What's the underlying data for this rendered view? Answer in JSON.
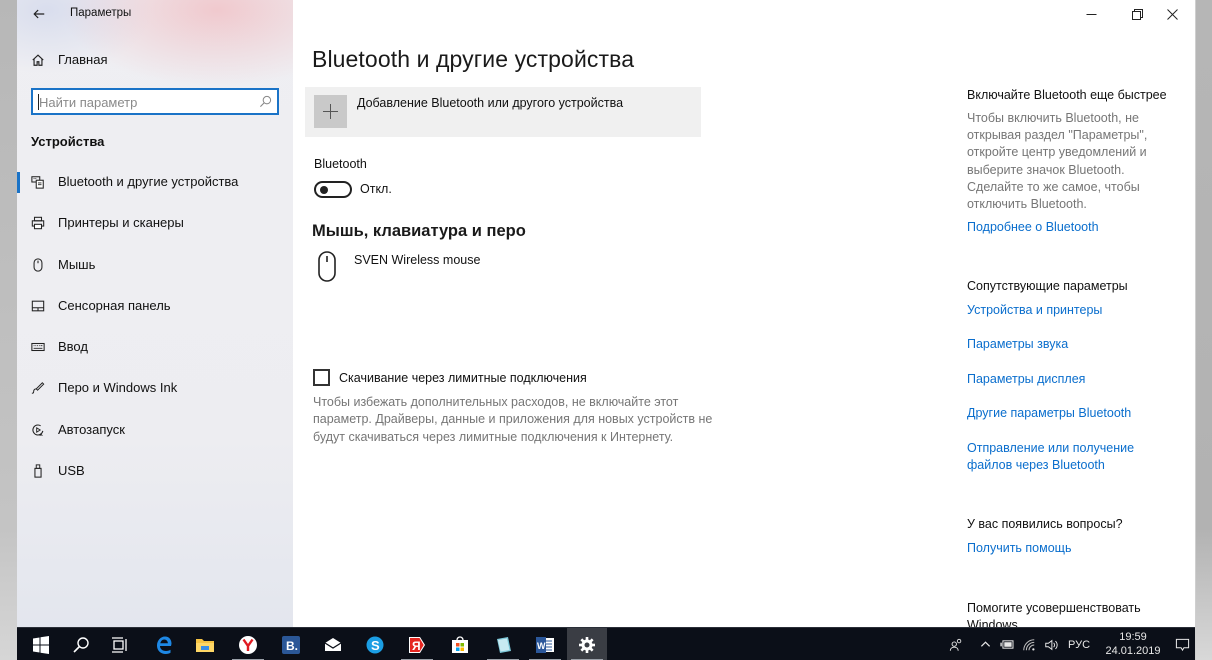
{
  "window": {
    "app_title": "Параметры",
    "controls": {
      "minimize": "minimize",
      "restore": "restore",
      "close": "close"
    }
  },
  "sidebar": {
    "home_label": "Главная",
    "search": {
      "placeholder": "Найти параметр",
      "value": ""
    },
    "section_title": "Устройства",
    "items": [
      {
        "label": "Bluetooth и другие устройства",
        "icon": "bluetooth-devices-icon",
        "active": true
      },
      {
        "label": "Принтеры и сканеры",
        "icon": "printer-icon",
        "active": false
      },
      {
        "label": "Мышь",
        "icon": "mouse-icon",
        "active": false
      },
      {
        "label": "Сенсорная панель",
        "icon": "touchpad-icon",
        "active": false
      },
      {
        "label": "Ввод",
        "icon": "keyboard-icon",
        "active": false
      },
      {
        "label": "Перо и Windows Ink",
        "icon": "pen-icon",
        "active": false
      },
      {
        "label": "Автозапуск",
        "icon": "autoplay-icon",
        "active": false
      },
      {
        "label": "USB",
        "icon": "usb-icon",
        "active": false
      }
    ]
  },
  "main": {
    "title": "Bluetooth и другие устройства",
    "add_device_label": "Добавление Bluetooth или другого устройства",
    "bluetooth_label": "Bluetooth",
    "bluetooth_toggle": {
      "on": false,
      "state_label": "Откл."
    },
    "mouse_section_title": "Мышь, клавиатура и перо",
    "devices": [
      {
        "name": "SVEN Wireless mouse",
        "icon": "mouse-icon"
      }
    ],
    "metered": {
      "checked": false,
      "label": "Скачивание через лимитные подключения",
      "description": "Чтобы избежать дополнительных расходов, не включайте этот параметр. Драйверы, данные и приложения для новых устройств не будут скачиваться через лимитные подключения к Интернету."
    }
  },
  "aside": {
    "quick_title": "Включайте Bluetooth еще быстрее",
    "quick_text": "Чтобы включить Bluetooth, не открывая раздел \"Параметры\", откройте центр уведомлений и выберите значок Bluetooth. Сделайте то же самое, чтобы отключить Bluetooth.",
    "quick_link": "Подробнее о Bluetooth",
    "related_title": "Сопутствующие параметры",
    "related_links": [
      "Устройства и принтеры",
      "Параметры звука",
      "Параметры дисплея",
      "Другие параметры Bluetooth",
      "Отправление или получение файлов через Bluetooth"
    ],
    "questions_title": "У вас появились вопросы?",
    "questions_link": "Получить помощь",
    "improve_title": "Помогите усовершенствовать Windows"
  },
  "taskbar": {
    "apps": [
      {
        "name": "start",
        "icon": "windows-start-icon"
      },
      {
        "name": "search",
        "icon": "search-icon"
      },
      {
        "name": "task-view",
        "icon": "task-view-icon"
      },
      {
        "name": "edge",
        "icon": "edge-icon"
      },
      {
        "name": "file-explorer",
        "icon": "folder-icon"
      },
      {
        "name": "yandex-browser",
        "icon": "yandex-browser-icon"
      },
      {
        "name": "app-b",
        "icon": "b-app-icon"
      },
      {
        "name": "mail",
        "icon": "mail-icon"
      },
      {
        "name": "skype",
        "icon": "skype-icon"
      },
      {
        "name": "yandex",
        "icon": "yandex-icon"
      },
      {
        "name": "store",
        "icon": "store-icon"
      },
      {
        "name": "notes",
        "icon": "notes-icon"
      },
      {
        "name": "word",
        "icon": "word-icon"
      },
      {
        "name": "settings",
        "icon": "settings-gear-icon"
      }
    ],
    "language": "РУС",
    "time": "19:59",
    "date": "24.01.2019"
  },
  "colors": {
    "accent": "#1a73c7",
    "link": "#0a6ecd",
    "taskbar": "#0b0f18",
    "secondary_text": "#767676"
  }
}
